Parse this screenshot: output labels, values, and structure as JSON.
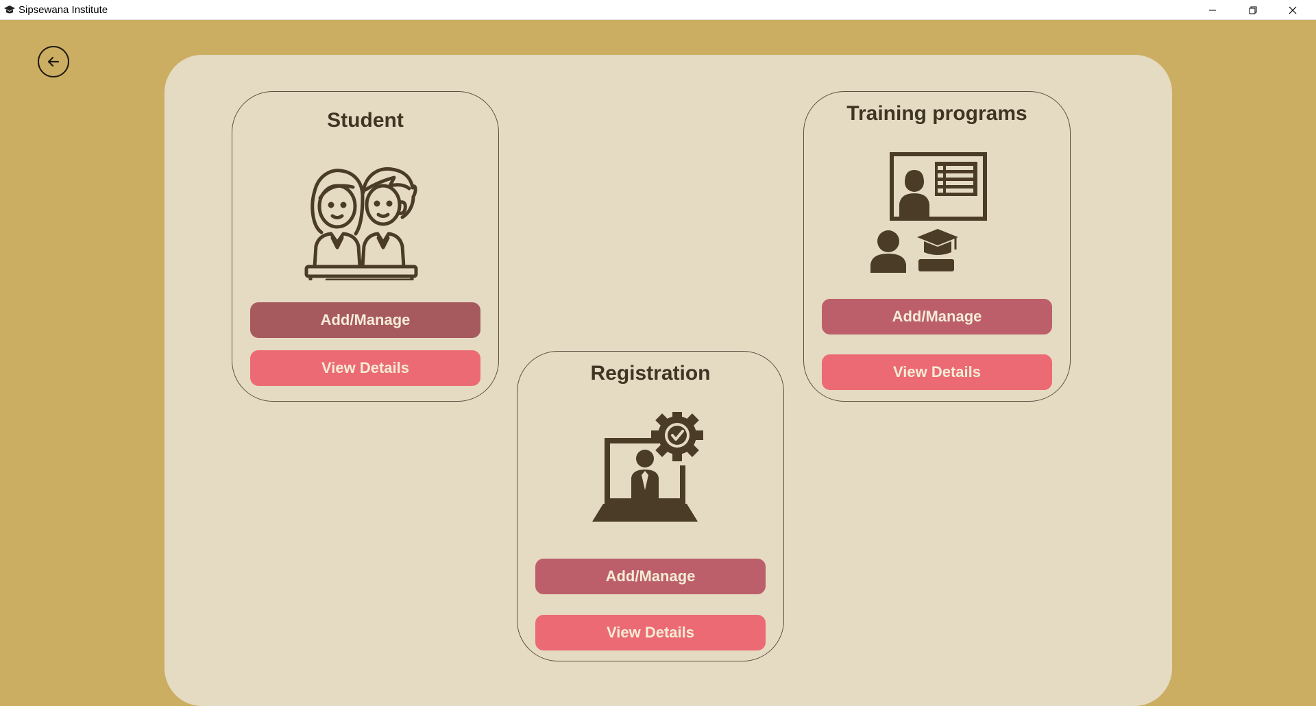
{
  "window": {
    "title": "Sipsewana Institute",
    "icon": "graduation-cap-icon"
  },
  "colors": {
    "background": "#ccae62",
    "panel": "#e5dbc3",
    "text": "#3f3523",
    "manage_button": "#bc5f6a",
    "view_button": "#ec6a74"
  },
  "nav": {
    "back_icon": "back-arrow-icon"
  },
  "cards": {
    "student": {
      "title": "Student",
      "icon": "students-icon",
      "manage_label": "Add/Manage",
      "view_label": "View Details"
    },
    "registration": {
      "title": "Registration",
      "icon": "laptop-registration-icon",
      "manage_label": "Add/Manage",
      "view_label": "View Details"
    },
    "training": {
      "title": "Training programs",
      "icon": "online-training-icon",
      "manage_label": "Add/Manage",
      "view_label": "View Details"
    }
  }
}
